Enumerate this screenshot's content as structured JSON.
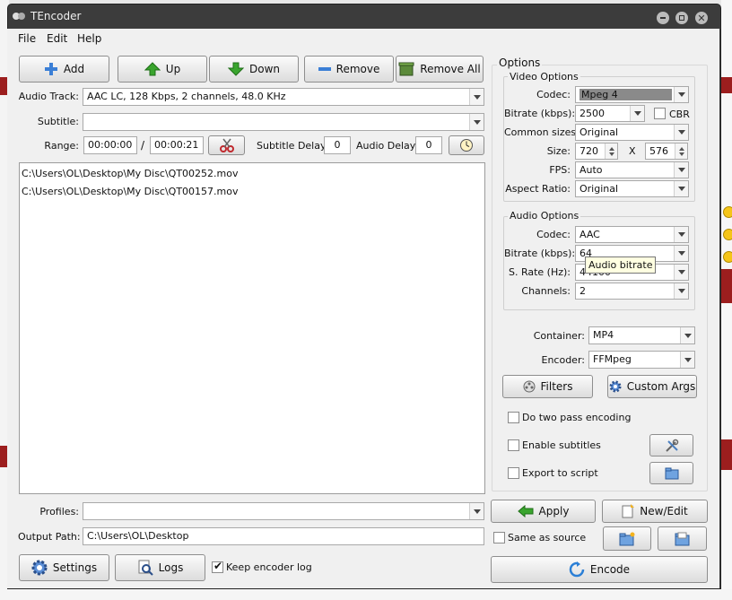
{
  "window": {
    "title": "TEncoder"
  },
  "menu": [
    "File",
    "Edit",
    "Help"
  ],
  "toolbar": {
    "add": "Add",
    "up": "Up",
    "down": "Down",
    "remove": "Remove",
    "remove_all": "Remove All"
  },
  "audio_track": {
    "label": "Audio Track:",
    "value": "AAC LC, 128 Kbps, 2 channels, 48.0 KHz"
  },
  "subtitle": {
    "label": "Subtitle:",
    "value": ""
  },
  "range": {
    "label": "Range:",
    "start": "00:00:00",
    "separator": "/",
    "end": "00:00:21"
  },
  "subtitle_delay": {
    "label": "Subtitle Delay:",
    "value": "0"
  },
  "audio_delay": {
    "label": "Audio Delay:",
    "value": "0"
  },
  "files": [
    "C:\\Users\\OL\\Desktop\\My Disc\\QT00252.mov",
    "C:\\Users\\OL\\Desktop\\My Disc\\QT00157.mov"
  ],
  "profiles": {
    "label": "Profiles:",
    "value": ""
  },
  "output_path": {
    "label": "Output Path:",
    "value": "C:\\Users\\OL\\Desktop"
  },
  "bottom_buttons": {
    "settings": "Settings",
    "logs": "Logs"
  },
  "keep_log": {
    "label": "Keep encoder log",
    "checked": true
  },
  "options": {
    "title": "Options",
    "video": {
      "title": "Video Options",
      "codec_label": "Codec:",
      "codec": "Mpeg 4",
      "bitrate_label": "Bitrate (kbps):",
      "bitrate": "2500",
      "cbr_label": "CBR",
      "sizes_label": "Common sizes:",
      "sizes": "Original",
      "size_label": "Size:",
      "width": "720",
      "x": "X",
      "height": "576",
      "fps_label": "FPS:",
      "fps": "Auto",
      "aspect_label": "Aspect Ratio:",
      "aspect": "Original"
    },
    "audio": {
      "title": "Audio Options",
      "codec_label": "Codec:",
      "codec": "AAC",
      "bitrate_label": "Bitrate (kbps):",
      "bitrate": "64",
      "tooltip": "Audio bitrate",
      "srate_label": "S. Rate (Hz):",
      "srate": "44100",
      "channels_label": "Channels:",
      "channels": "2"
    },
    "container_label": "Container:",
    "container": "MP4",
    "encoder_label": "Encoder:",
    "encoder": "FFMpeg",
    "filters": "Filters",
    "custom_args": "Custom Args",
    "two_pass": "Do two pass encoding",
    "enable_subtitles": "Enable subtitles",
    "export_script": "Export to script"
  },
  "actions": {
    "apply": "Apply",
    "new_edit": "New/Edit",
    "same_as_source": "Same as source",
    "encode": "Encode"
  },
  "colors": {
    "accent_green": "#3aa52e",
    "title_bar": "#3c3c3c",
    "red_bg": "#9c1e1e"
  }
}
